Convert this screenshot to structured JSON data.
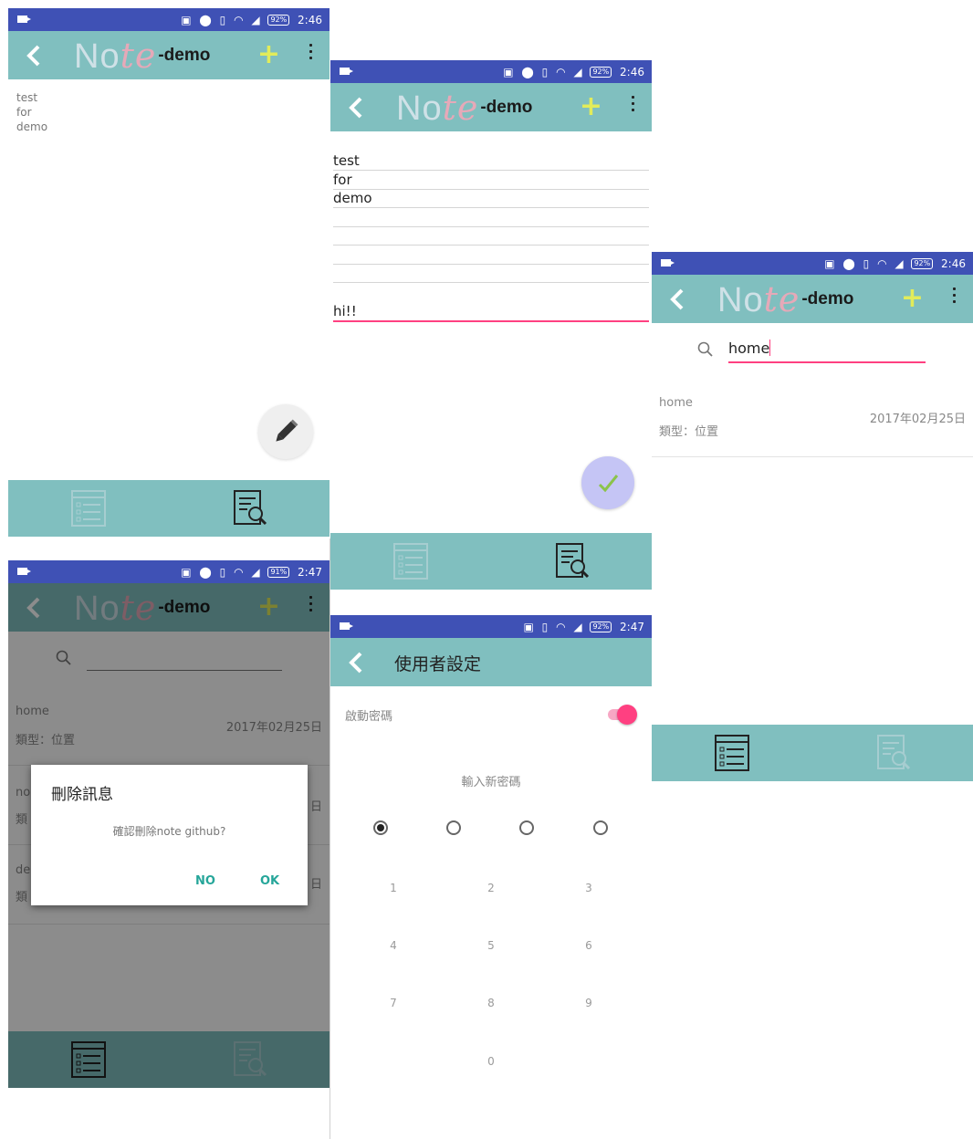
{
  "status": {
    "time_a": "2:46",
    "time_b": "2:47",
    "battery_92": "92%",
    "battery_91": "91%"
  },
  "appbar": {
    "logo_part1": "No",
    "logo_part2": "te",
    "logo_suffix": "-demo",
    "add_label": "+"
  },
  "screen1": {
    "note_lines": [
      "test",
      "for",
      "demo"
    ]
  },
  "screen2": {
    "lines": [
      "test",
      "for",
      "demo",
      "",
      "",
      "",
      "",
      "hi!!"
    ]
  },
  "screen3": {
    "search_value": "home",
    "result": {
      "title": "home",
      "type": "類型：位置",
      "date": "2017年02月25日"
    }
  },
  "screen4": {
    "result": {
      "title": "home",
      "type": "類型：位置",
      "date": "2017年02月25日"
    },
    "row2_prefix": "no",
    "row2_type_prefix": "類",
    "row2_date_suffix": "日",
    "row3_prefix": "de",
    "row3_type_prefix": "類",
    "row3_date_suffix": "日",
    "dialog": {
      "title": "刪除訊息",
      "message": "確認刪除note github?",
      "no": "NO",
      "ok": "OK"
    }
  },
  "screen5": {
    "title": "使用者設定",
    "toggle_label": "啟動密碼",
    "prompt": "輸入新密碼",
    "keys": [
      "1",
      "2",
      "3",
      "4",
      "5",
      "6",
      "7",
      "8",
      "9",
      "0"
    ]
  },
  "colors": {
    "statusbar": "#3f51b5",
    "appbar": "#80bfbf",
    "accent_pink": "#ff4081",
    "add_yellow": "#e2ec5a",
    "fab_done": "#c5c5f5",
    "check_green": "#8bc34a"
  }
}
